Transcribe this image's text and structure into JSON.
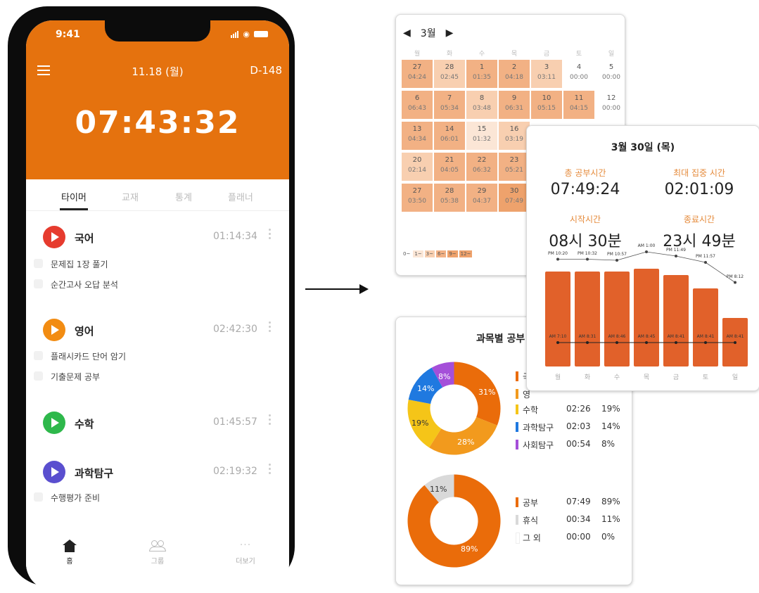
{
  "phone": {
    "status_time": "9:41",
    "header": {
      "date": "11.18 (월)",
      "dday": "D-148",
      "timer": "07:43:32"
    },
    "tabs": [
      {
        "label": "타이머",
        "active": true
      },
      {
        "label": "교재",
        "active": false
      },
      {
        "label": "통계",
        "active": false
      },
      {
        "label": "플래너",
        "active": false
      }
    ],
    "subjects": [
      {
        "name": "국어",
        "time": "01:14:34",
        "color": "#e63b2e",
        "todos": [
          "문제집 1장 풀기",
          "순간고사 오답 분석"
        ]
      },
      {
        "name": "영어",
        "time": "02:42:30",
        "color": "#f28c12",
        "todos": [
          "플래시카드 단어 암기",
          "기출문제 공부"
        ]
      },
      {
        "name": "수학",
        "time": "01:45:57",
        "color": "#2eb84b",
        "todos": []
      },
      {
        "name": "과학탐구",
        "time": "02:19:32",
        "color": "#5a4fcf",
        "todos": [
          "수행평가 준비"
        ]
      }
    ],
    "nav": [
      {
        "label": "홈",
        "icon": "home-icon",
        "active": true
      },
      {
        "label": "그룹",
        "icon": "group-icon",
        "active": false
      },
      {
        "label": "더보기",
        "icon": "more-icon",
        "active": false
      }
    ]
  },
  "calendar": {
    "month": "3월",
    "weekdays": [
      "월",
      "화",
      "수",
      "목",
      "금",
      "토",
      "일"
    ],
    "days": [
      {
        "d": "27",
        "t": "04:24",
        "lvl": 3
      },
      {
        "d": "28",
        "t": "02:45",
        "lvl": 2
      },
      {
        "d": "1",
        "t": "01:35",
        "lvl": 3
      },
      {
        "d": "2",
        "t": "04:18",
        "lvl": 3
      },
      {
        "d": "3",
        "t": "03:11",
        "lvl": 2
      },
      {
        "d": "4",
        "t": "00:00",
        "lvl": 0
      },
      {
        "d": "5",
        "t": "00:00",
        "lvl": 0
      },
      {
        "d": "6",
        "t": "06:43",
        "lvl": 3
      },
      {
        "d": "7",
        "t": "05:34",
        "lvl": 3
      },
      {
        "d": "8",
        "t": "03:48",
        "lvl": 2
      },
      {
        "d": "9",
        "t": "06:31",
        "lvl": 3
      },
      {
        "d": "10",
        "t": "05:15",
        "lvl": 3
      },
      {
        "d": "11",
        "t": "04:15",
        "lvl": 3
      },
      {
        "d": "12",
        "t": "00:00",
        "lvl": 0
      },
      {
        "d": "13",
        "t": "04:34",
        "lvl": 3
      },
      {
        "d": "14",
        "t": "06:01",
        "lvl": 3
      },
      {
        "d": "15",
        "t": "01:32",
        "lvl": 1
      },
      {
        "d": "16",
        "t": "03:19",
        "lvl": 2
      },
      {
        "d": "",
        "t": "",
        "lvl": 0
      },
      {
        "d": "",
        "t": "",
        "lvl": 0
      },
      {
        "d": "",
        "t": "",
        "lvl": 0
      },
      {
        "d": "20",
        "t": "02:14",
        "lvl": 2
      },
      {
        "d": "21",
        "t": "04:05",
        "lvl": 3
      },
      {
        "d": "22",
        "t": "06:32",
        "lvl": 3
      },
      {
        "d": "23",
        "t": "05:21",
        "lvl": 3
      },
      {
        "d": "",
        "t": "",
        "lvl": 0
      },
      {
        "d": "",
        "t": "",
        "lvl": 0
      },
      {
        "d": "",
        "t": "",
        "lvl": 0
      },
      {
        "d": "27",
        "t": "03:50",
        "lvl": 3
      },
      {
        "d": "28",
        "t": "05:38",
        "lvl": 3
      },
      {
        "d": "29",
        "t": "04:37",
        "lvl": 3
      },
      {
        "d": "30",
        "t": "07:49",
        "lvl": 4
      },
      {
        "d": "",
        "t": "",
        "lvl": 0
      },
      {
        "d": "",
        "t": "",
        "lvl": 0
      },
      {
        "d": "",
        "t": "",
        "lvl": 0
      }
    ],
    "legend": [
      "0~",
      "1~",
      "3~",
      "6~",
      "9~",
      "12~"
    ],
    "level_colors": [
      "#ffffff",
      "#fbe6d6",
      "#f8cfb0",
      "#f2b184",
      "#eea26c"
    ]
  },
  "detail": {
    "title": "3월 30일 (목)",
    "total_label": "총 공부시간",
    "total_value": "07:49:24",
    "max_label": "최대 집중 시간",
    "max_value": "02:01:09",
    "start_label": "시작시간",
    "start_value": "08시 30분",
    "end_label": "종료시간",
    "end_value": "23시 49분",
    "weekday_labels": [
      "월",
      "화",
      "수",
      "목",
      "금",
      "토",
      "일"
    ],
    "bar_values": [
      9,
      9,
      9,
      9.3,
      8.7,
      7.4,
      4.6
    ],
    "line_values": [
      8.7,
      8.7,
      8.6,
      9.4,
      9.0,
      8.4,
      6.5
    ],
    "bar_labels": [
      "AM 7:10",
      "AM 8:31",
      "AM 8:46",
      "AM 8:45",
      "AM 8:41",
      "AM 8:41",
      "AM 8:41"
    ],
    "line_labels": [
      "PM 10:20",
      "PM 10:32",
      "PM 10:57",
      "AM 1:00",
      "PM 11:49",
      "PM 11:57",
      "PM 8:12"
    ]
  },
  "subject_pie": {
    "title": "과목별 공부",
    "slices": [
      {
        "name": "국어",
        "pct": 31,
        "color": "#ea6c0a"
      },
      {
        "name": "영어",
        "pct": 28,
        "color": "#f29a1d"
      },
      {
        "name": "수학",
        "pct": 19,
        "color": "#f5c518",
        "time": "02:26",
        "pct_text": "19%"
      },
      {
        "name": "과학탐구",
        "pct": 14,
        "color": "#1f79e0",
        "time": "02:03",
        "pct_text": "14%"
      },
      {
        "name": "사회탐구",
        "pct": 8,
        "color": "#a54fd9",
        "time": "00:54",
        "pct_text": "8%"
      }
    ],
    "legend_visible_partial": [
      "국",
      "영"
    ]
  },
  "ratio_pie": {
    "slices": [
      {
        "name": "공부",
        "time": "07:49",
        "pct": 89,
        "pct_text": "89%",
        "color": "#ea6c0a"
      },
      {
        "name": "휴식",
        "time": "00:34",
        "pct": 11,
        "pct_text": "11%",
        "color": "#d9d9d9"
      },
      {
        "name": "그 외",
        "time": "00:00",
        "pct": 0,
        "pct_text": "0%",
        "color": "#ffffff"
      }
    ]
  },
  "chart_data": [
    {
      "type": "bar",
      "title": "3월 30일 (목)",
      "categories": [
        "월",
        "화",
        "수",
        "목",
        "금",
        "토",
        "일"
      ],
      "series": [
        {
          "values": [
            9,
            9,
            9,
            9.3,
            8.7,
            7.4,
            4.6
          ]
        },
        {
          "values": [
            8.7,
            8.7,
            8.6,
            9.4,
            9.0,
            8.4,
            6.5
          ]
        }
      ]
    },
    {
      "type": "pie",
      "title": "과목별 공부",
      "categories": [
        "국어",
        "영어",
        "수학",
        "과학탐구",
        "사회탐구"
      ],
      "values": [
        31,
        28,
        19,
        14,
        8
      ]
    },
    {
      "type": "pie",
      "categories": [
        "공부",
        "휴식",
        "그 외"
      ],
      "values": [
        89,
        11,
        0
      ]
    }
  ]
}
